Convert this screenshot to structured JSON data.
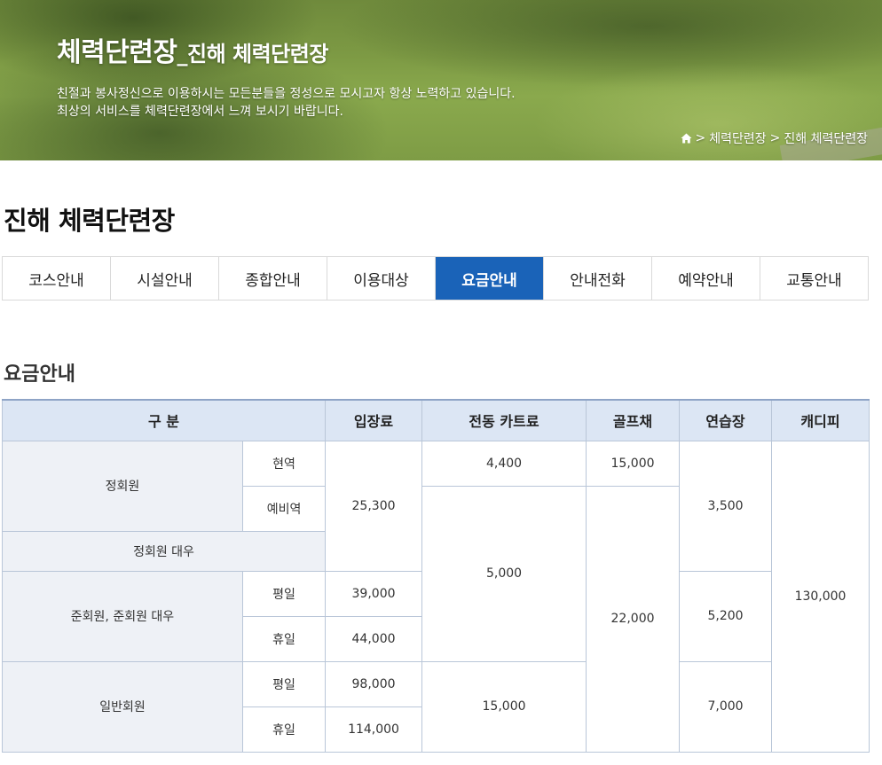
{
  "hero": {
    "title_main": "체력단련장",
    "title_sub": "_진해 체력단련장",
    "desc_line1": "친절과 봉사정신으로 이용하시는 모든분들을 정성으로 모시고자 항상 노력하고 있습니다.",
    "desc_line2": "최상의 서비스를 체력단련장에서 느껴 보시기 바랍니다.",
    "breadcrumb": [
      "체력단련장",
      "진해 체력단련장"
    ]
  },
  "page_title": "진해 체력단련장",
  "tabs": [
    "코스안내",
    "시설안내",
    "종합안내",
    "이용대상",
    "요금안내",
    "안내전화",
    "예약안내",
    "교통안내"
  ],
  "active_tab": "요금안내",
  "section_title": "요금안내",
  "table": {
    "headers": {
      "category": "구 분",
      "entry": "입장료",
      "cart": "전동 카트료",
      "clubs": "골프채",
      "practice": "연습장",
      "caddie": "캐디피"
    },
    "rows": {
      "regular": "정회원",
      "active": "현역",
      "reserve": "예비역",
      "regular_equiv": "정회원 대우",
      "associate": "준회원, 준회원 대우",
      "weekday": "평일",
      "holiday": "휴일",
      "general": "일반회원"
    },
    "values": {
      "entry_regular": "25,300",
      "entry_assoc_weekday": "39,000",
      "entry_assoc_holiday": "44,000",
      "entry_general_weekday": "98,000",
      "entry_general_holiday": "114,000",
      "cart_active": "4,400",
      "cart_mid": "5,000",
      "cart_general": "15,000",
      "clubs_active": "15,000",
      "clubs_rest": "22,000",
      "practice_regular": "3,500",
      "practice_assoc": "5,200",
      "practice_general": "7,000",
      "caddie": "130,000"
    }
  }
}
